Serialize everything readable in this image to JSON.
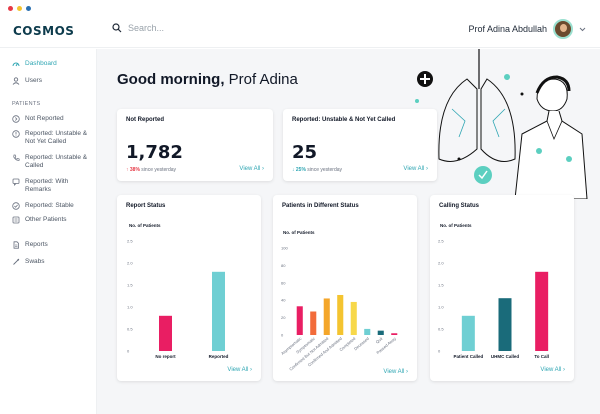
{
  "window": {
    "dot_colors": [
      "#e63946",
      "#f4c430",
      "#2a6fb0"
    ]
  },
  "header": {
    "logo": "COSMOS",
    "search_placeholder": "Search...",
    "user_name": "Prof Adina Abdullah"
  },
  "sidebar": {
    "items_top": [
      {
        "label": "Dashboard",
        "icon": "dashboard-icon"
      },
      {
        "label": "Users",
        "icon": "user-icon"
      }
    ],
    "section_label": "PATIENTS",
    "patient_items": [
      {
        "label": "Not Reported",
        "icon": "arrow-circle-icon"
      },
      {
        "label": "Reported: Unstable & Not Yet Called",
        "icon": "alert-circle-icon"
      },
      {
        "label": "Reported: Unstable & Called",
        "icon": "phone-icon"
      },
      {
        "label": "Reported: With Remarks",
        "icon": "comment-icon"
      },
      {
        "label": "Reported: Stable",
        "icon": "check-circle-icon"
      },
      {
        "label": "Other Patients",
        "icon": "list-icon"
      }
    ],
    "items_bottom": [
      {
        "label": "Reports",
        "icon": "document-icon"
      },
      {
        "label": "Swabs",
        "icon": "swab-icon"
      }
    ]
  },
  "main": {
    "greeting_prefix": "Good morning,",
    "greeting_name": "Prof Adina"
  },
  "stats": [
    {
      "title": "Not Reported",
      "value": "1,782",
      "delta": "38%",
      "direction": "up",
      "since": "since yesterday",
      "view_all": "View All ›"
    },
    {
      "title": "Reported: Unstable & Not Yet Called",
      "value": "25",
      "delta": "25%",
      "direction": "down",
      "since": "since yesterday",
      "view_all": "View All ›"
    }
  ],
  "charts": {
    "view_all": "View All ›"
  },
  "chart_data": [
    {
      "type": "bar",
      "title": "Report Status",
      "ylabel": "No. of Patients",
      "ylim": [
        0,
        2.5
      ],
      "yticks": [
        "0",
        "0.5",
        "1.0",
        "1.5",
        "2.0",
        "2.5"
      ],
      "categories": [
        "No report",
        "Reported"
      ],
      "values": [
        0.8,
        1.8
      ],
      "colors": [
        "#e91e63",
        "#6fcfd3"
      ]
    },
    {
      "type": "bar",
      "title": "Patients in Different Status",
      "ylabel": "No. of Patients",
      "ylim": [
        0,
        100
      ],
      "yticks": [
        "0",
        "20",
        "40",
        "60",
        "80",
        "100"
      ],
      "categories": [
        "Asymptomatic",
        "Symptomatic",
        "Confirmed But Not Admitted",
        "Confirmed And Admitted",
        "Completed",
        "Deceased",
        "Quit",
        "Passed Away"
      ],
      "values": [
        33,
        27,
        42,
        46,
        38,
        7,
        5,
        2
      ],
      "colors": [
        "#e91e63",
        "#f26b3a",
        "#f4a62a",
        "#f4c430",
        "#f7d84a",
        "#6fcfd3",
        "#1a6b7a",
        "#e91e63"
      ]
    },
    {
      "type": "bar",
      "title": "Calling Status",
      "ylabel": "No. of Patients",
      "ylim": [
        0,
        2.5
      ],
      "yticks": [
        "0",
        "0.5",
        "1.0",
        "1.5",
        "2.0",
        "2.5"
      ],
      "categories": [
        "Patient Called",
        "UHMC Called",
        "To Call"
      ],
      "values": [
        0.8,
        1.2,
        1.8
      ],
      "colors": [
        "#6fcfd3",
        "#1a6b7a",
        "#e91e63"
      ]
    }
  ]
}
